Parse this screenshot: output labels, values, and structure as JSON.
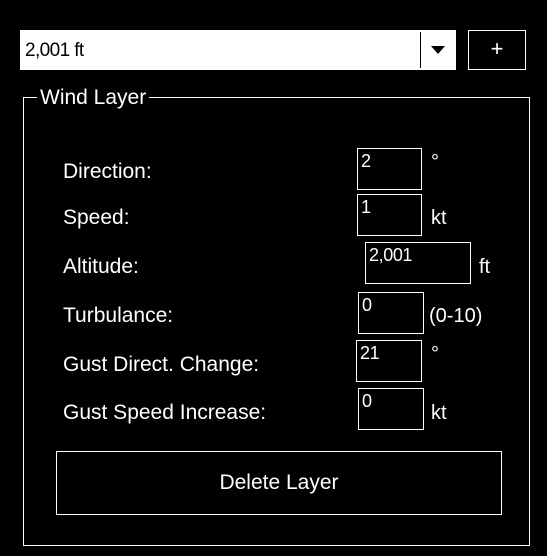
{
  "layer_selector": {
    "value": "2,001 ft",
    "add_label": "+"
  },
  "group": {
    "title": "Wind Layer",
    "fields": [
      {
        "label": "Direction:",
        "value": "2",
        "unit": "°"
      },
      {
        "label": "Speed:",
        "value": "1",
        "unit": "kt"
      },
      {
        "label": "Altitude:",
        "value": "2,001",
        "unit": "ft"
      },
      {
        "label": "Turbulance:",
        "value": "0",
        "unit": "(0-10)"
      },
      {
        "label": "Gust Direct. Change:",
        "value": "21",
        "unit": "°"
      },
      {
        "label": "Gust Speed Increase:",
        "value": "0",
        "unit": "kt"
      }
    ],
    "delete_label": "Delete Layer"
  },
  "icons": {
    "dropdown": "chevron-down-icon"
  },
  "colors": {
    "background": "#000000",
    "foreground": "#ffffff"
  }
}
